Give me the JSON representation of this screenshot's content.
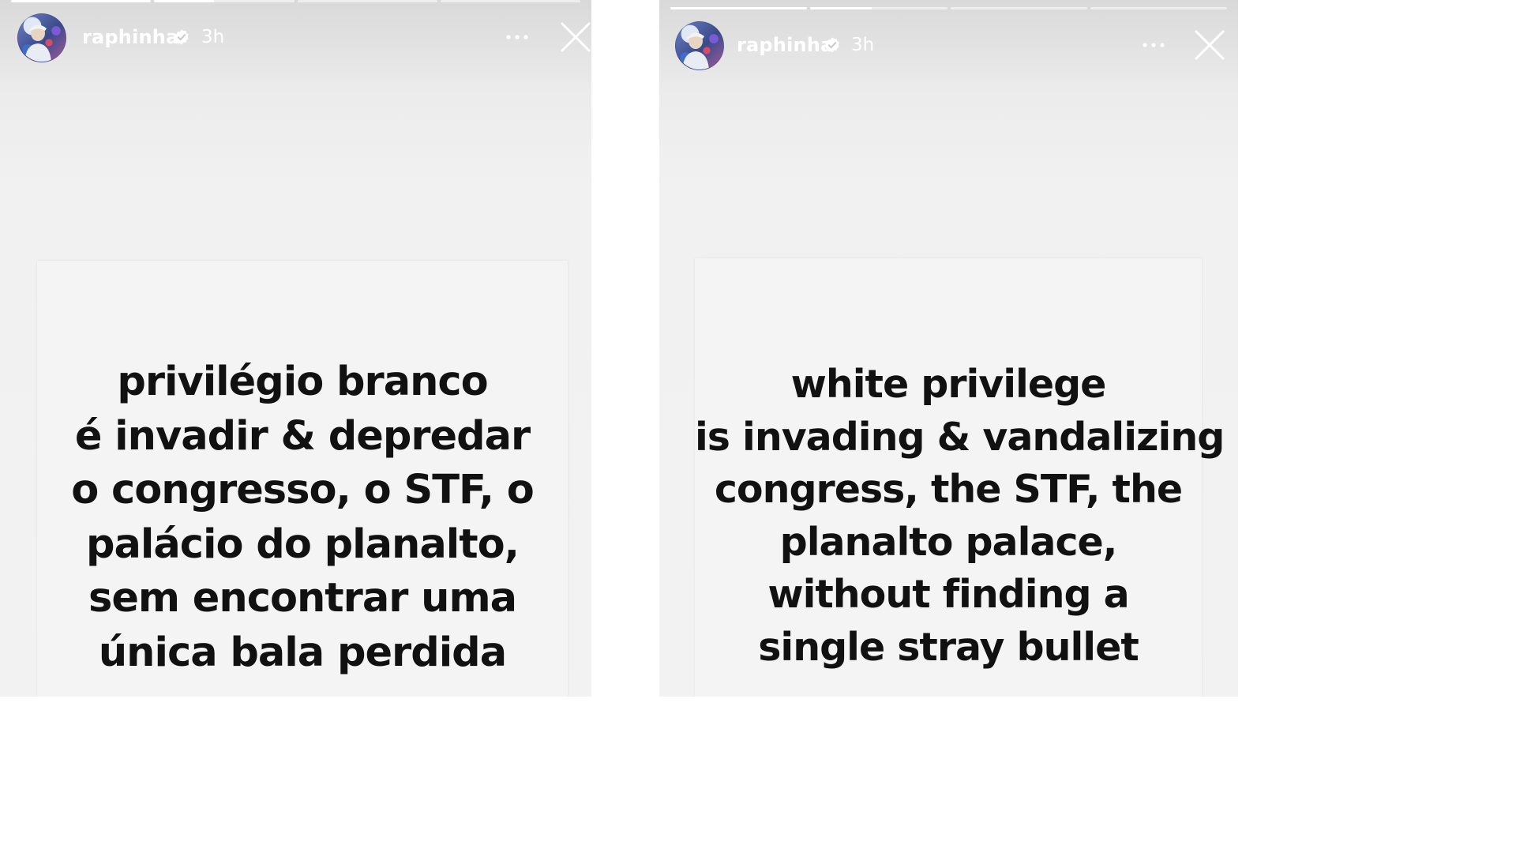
{
  "stories": [
    {
      "username": "raphinha",
      "time": "3h",
      "progress": [
        1,
        0.43,
        0,
        0
      ],
      "lines": [
        "privilégio branco",
        "é invadir & depredar",
        "o congresso, o STF, o",
        "palácio do planalto,",
        "sem encontrar uma",
        "única bala perdida"
      ]
    },
    {
      "username": "raphinha",
      "time": "3h",
      "progress": [
        1,
        0.45,
        0,
        0
      ],
      "lines": [
        "white privilege",
        "is invading & vandalizing",
        "congress, the STF, the",
        "planalto palace,",
        "without finding a",
        "single stray bullet"
      ]
    }
  ],
  "icons": {
    "verified": "verified-badge-icon",
    "more": "more-options-icon",
    "close": "close-icon"
  }
}
